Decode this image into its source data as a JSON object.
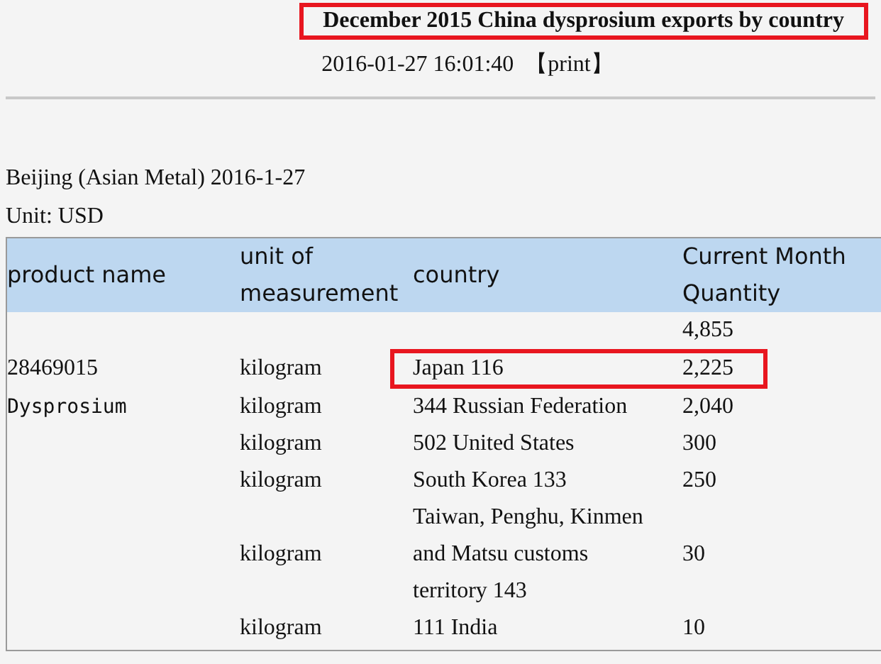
{
  "title": {
    "text": "December 2015 China dysprosium exports by country",
    "highlighted": true
  },
  "timestamp": "2016-01-27 16:01:40",
  "print_link": "【print】",
  "byline": "Beijing (Asian Metal) 2016-1-27",
  "unit": "Unit: USD",
  "table": {
    "columns": [
      "product name",
      "unit of measurement",
      "country",
      "Current Month Quantity"
    ],
    "rows": [
      {
        "highlighted": false,
        "quantity": "4,855"
      },
      {
        "highlighted": true,
        "product": {
          "text": "28469015",
          "kind": "plain"
        },
        "unit": "kilogram",
        "country": "Japan 116",
        "quantity": "2,225"
      },
      {
        "highlighted": false,
        "product": {
          "text": "Dysprosium",
          "kind": "mono"
        },
        "unit": "kilogram",
        "country": "344 Russian Federation",
        "quantity": "2,040"
      },
      {
        "highlighted": false,
        "unit": "kilogram",
        "country": "502 United States",
        "quantity": "300"
      },
      {
        "highlighted": false,
        "unit": "kilogram",
        "country": "South Korea 133",
        "quantity": "250"
      },
      {
        "highlighted": false,
        "unit": "kilogram",
        "country": "Taiwan, Penghu, Kinmen and Matsu customs territory 143",
        "quantity": "30"
      },
      {
        "highlighted": false,
        "unit": "kilogram",
        "country": "111 India",
        "quantity": "10"
      }
    ]
  }
}
